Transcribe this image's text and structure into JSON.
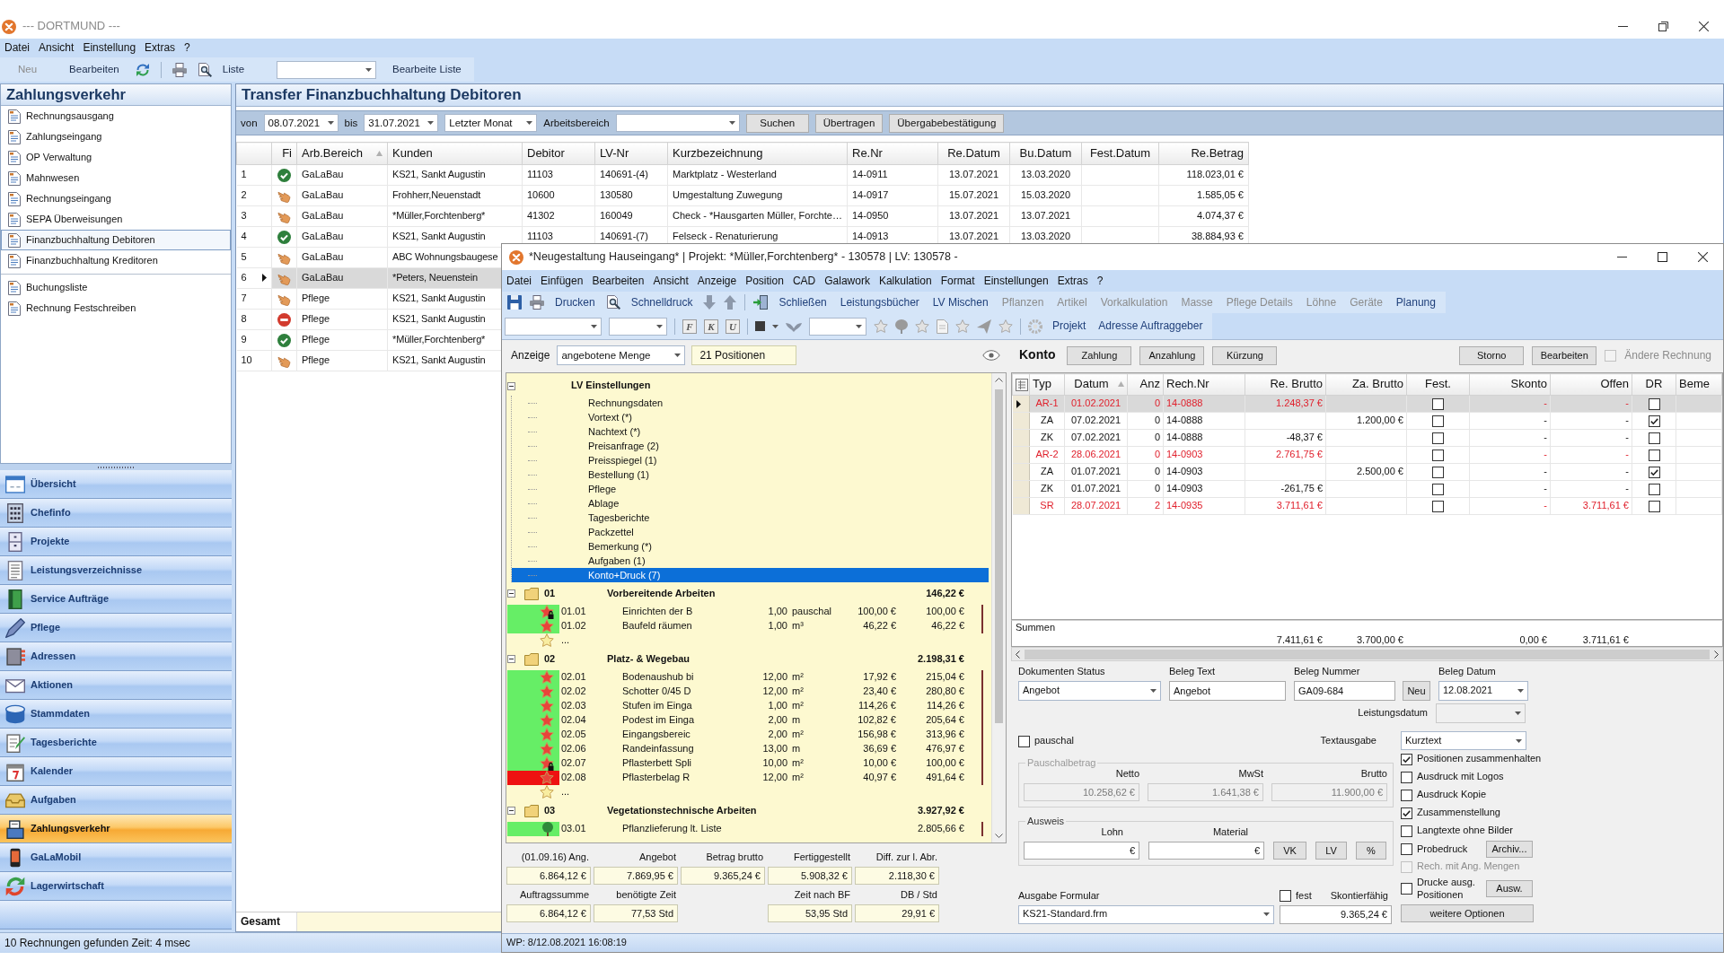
{
  "window": {
    "title": "--- DORTMUND ---"
  },
  "menu": [
    "Datei",
    "Ansicht",
    "Einstellung",
    "Extras",
    "?"
  ],
  "toolbar": {
    "buttons": [
      {
        "label": "Neu",
        "disabled": true
      },
      {
        "label": "Bearbeiten",
        "disabled": false
      }
    ],
    "list_label": "Liste",
    "list_button": "Bearbeite Liste"
  },
  "sidebar": {
    "title": "Zahlungsverkehr",
    "groups": [
      [
        {
          "label": "Rechnungsausgang",
          "selected": false
        },
        {
          "label": "Zahlungseingang",
          "selected": false
        },
        {
          "label": "OP Verwaltung",
          "selected": false
        },
        {
          "label": "Mahnwesen",
          "selected": false
        },
        {
          "label": "Rechnungseingang",
          "selected": false
        },
        {
          "label": "SEPA Überweisungen",
          "selected": false
        },
        {
          "label": "Finanzbuchhaltung Debitoren",
          "selected": true
        },
        {
          "label": "Finanzbuchhaltung Kreditoren",
          "selected": false
        }
      ],
      [
        {
          "label": "Buchungsliste",
          "selected": false
        },
        {
          "label": "Rechnung Festschreiben",
          "selected": false
        }
      ]
    ],
    "modules": [
      {
        "label": "Übersicht",
        "selected": false
      },
      {
        "label": "Chefinfo",
        "selected": false
      },
      {
        "label": "Projekte",
        "selected": false
      },
      {
        "label": "Leistungsverzeichnisse",
        "selected": false
      },
      {
        "label": "Service Aufträge",
        "selected": false
      },
      {
        "label": "Pflege",
        "selected": false
      },
      {
        "label": "Adressen",
        "selected": false
      },
      {
        "label": "Aktionen",
        "selected": false
      },
      {
        "label": "Stammdaten",
        "selected": false
      },
      {
        "label": "Tagesberichte",
        "selected": false
      },
      {
        "label": "Kalender",
        "selected": false
      },
      {
        "label": "Aufgaben",
        "selected": false
      },
      {
        "label": "Zahlungsverkehr",
        "selected": true
      },
      {
        "label": "GaLaMobil",
        "selected": false
      },
      {
        "label": "Lagerwirtschaft",
        "selected": false
      }
    ]
  },
  "transfer": {
    "title": "Transfer Finanzbuchhaltung Debitoren",
    "filter": {
      "from_label": "von",
      "from": "08.07.2021",
      "to_label": "bis",
      "to": "31.07.2021",
      "period": "Letzter Monat",
      "area_label": "Arbeitsbereich",
      "buttons": [
        "Suchen",
        "Übertragen",
        "Übergabebestätigung"
      ]
    },
    "table": {
      "columns": [
        {
          "label": "Fi",
          "sorted": false
        },
        {
          "label": "Arb.Bereich",
          "sorted": true
        },
        {
          "label": "Kunden",
          "sorted": false
        },
        {
          "label": "Debitor",
          "sorted": false
        },
        {
          "label": "LV-Nr",
          "sorted": false
        },
        {
          "label": "Kurzbezeichnung",
          "sorted": false
        },
        {
          "label": "Re.Nr",
          "sorted": false
        },
        {
          "label": "Re.Datum",
          "sorted": false
        },
        {
          "label": "Bu.Datum",
          "sorted": false
        },
        {
          "label": "Fest.Datum",
          "sorted": false
        },
        {
          "label": "Re.Betrag",
          "sorted": false
        }
      ],
      "rows": [
        {
          "number": "1",
          "kind": "ok",
          "selected": false,
          "cells": [
            "",
            "GaLaBau",
            "KS21, Sankt Augustin",
            "11103",
            "140691-(4)",
            "Marktplatz - Westerland",
            "14-0911",
            "13.07.2021",
            "13.03.2020",
            "",
            "118.023,01 €"
          ]
        },
        {
          "number": "2",
          "kind": "open",
          "selected": false,
          "cells": [
            "",
            "GaLaBau",
            "Frohherr,Neuenstadt",
            "10600",
            "130580",
            "Umgestaltung Zuwegung",
            "14-0917",
            "15.07.2021",
            "15.03.2020",
            "",
            "1.585,05 €"
          ]
        },
        {
          "number": "3",
          "kind": "open",
          "selected": false,
          "cells": [
            "",
            "GaLaBau",
            "*Müller,Forchtenberg*",
            "41302",
            "160049",
            "Check - *Hausgarten Müller, Forchte…",
            "14-0950",
            "13.07.2021",
            "13.07.2021",
            "",
            "4.074,37 €"
          ]
        },
        {
          "number": "4",
          "kind": "ok",
          "selected": false,
          "cells": [
            "",
            "GaLaBau",
            "KS21, Sankt Augustin",
            "11103",
            "140691-(7)",
            "Felseck - Renaturierung",
            "14-0913",
            "13.07.2021",
            "13.03.2020",
            "",
            "38.884,93 €"
          ]
        },
        {
          "number": "5",
          "kind": "open",
          "selected": false,
          "cells": [
            "",
            "GaLaBau",
            "ABC  Wohnungsbaugese"
          ]
        },
        {
          "number": "6",
          "kind": "open",
          "selected": true,
          "cells": [
            "",
            "GaLaBau",
            "*Peters, Neuenstein"
          ]
        },
        {
          "number": "7",
          "kind": "open",
          "selected": false,
          "cells": [
            "",
            "Pflege",
            "KS21, Sankt Augustin"
          ]
        },
        {
          "number": "8",
          "kind": "error",
          "selected": false,
          "cells": [
            "",
            "Pflege",
            "KS21, Sankt Augustin"
          ]
        },
        {
          "number": "9",
          "kind": "ok",
          "selected": false,
          "cells": [
            "",
            "Pflege",
            "*Müller,Forchtenberg*"
          ]
        },
        {
          "number": "10",
          "kind": "open",
          "selected": false,
          "cells": [
            "",
            "Pflege",
            "KS21, Sankt Augustin"
          ]
        }
      ]
    },
    "footer": "Gesamt"
  },
  "status_bar": "10 Rechnungen gefunden Zeit: 4 msec",
  "project_window": {
    "title": "*Neugestaltung Hauseingang* | Projekt: *Müller,Forchtenberg* - 130578 | LV: 130578 -",
    "menu": [
      "Datei",
      "Einfügen",
      "Bearbeiten",
      "Ansicht",
      "Anzeige",
      "Position",
      "CAD",
      "Galawork",
      "Kalkulation",
      "Format",
      "Einstellungen",
      "Extras",
      "?"
    ],
    "toolbar": [
      {
        "label": "Drucken",
        "disabled": false
      },
      {
        "label": "Schnelldruck",
        "disabled": false
      },
      {
        "label": "Schließen",
        "disabled": false
      },
      {
        "label": "Leistungsbücher",
        "disabled": false
      },
      {
        "label": "LV Mischen",
        "disabled": false
      },
      {
        "label": "Pflanzen",
        "disabled": true
      },
      {
        "label": "Artikel",
        "disabled": true
      },
      {
        "label": "Vorkalkulation",
        "disabled": true
      },
      {
        "label": "Masse",
        "disabled": true
      },
      {
        "label": "Pflege Details",
        "disabled": true
      },
      {
        "label": "Löhne",
        "disabled": true
      },
      {
        "label": "Geräte",
        "disabled": true
      },
      {
        "label": "Planung",
        "disabled": false
      }
    ],
    "format_buttons": [
      "F",
      "K",
      "U"
    ],
    "links": [
      "Projekt",
      "Adresse Auftraggeber"
    ],
    "display": {
      "label": "Anzeige",
      "value": "angebotene Menge",
      "count": "21 Positionen"
    },
    "tree": {
      "settings": {
        "label": "LV Einstellungen",
        "expanded": true,
        "children": [
          {
            "label": "Rechnungsdaten",
            "selected": false
          },
          {
            "label": "Vortext (*)",
            "selected": false
          },
          {
            "label": "Nachtext (*)",
            "selected": false
          },
          {
            "label": "Preisanfrage (2)",
            "selected": false
          },
          {
            "label": "Preisspiegel (1)",
            "selected": false
          },
          {
            "label": "Bestellung (1)",
            "selected": false
          },
          {
            "label": "Pflege",
            "selected": false
          },
          {
            "label": "Ablage",
            "selected": false
          },
          {
            "label": "Tagesberichte",
            "selected": false
          },
          {
            "label": "Packzettel",
            "selected": false
          },
          {
            "label": "Bemerkung (*)",
            "selected": false
          },
          {
            "label": "Aufgaben (1)",
            "selected": false
          },
          {
            "label": "Konto+Druck (7)",
            "selected": true
          }
        ]
      },
      "groups": [
        {
          "number": "01",
          "title": "Vorbereitende Arbeiten",
          "total": "146,22 €",
          "expanded": true,
          "children": [
            {
              "kind": "item",
              "number": "01.01",
              "text": "Einrichten der B",
              "quantity": "1,00",
              "unit": "pauschal",
              "price": "100,00 €",
              "total": "100,00 €",
              "color": "#66ee66",
              "locked": true
            },
            {
              "kind": "item",
              "number": "01.02",
              "text": "Baufeld räumen",
              "quantity": "1,00",
              "unit": "m³",
              "price": "46,22 €",
              "total": "46,22 €",
              "color": "#66ee66",
              "locked": false
            },
            {
              "kind": "add",
              "text": "..."
            }
          ]
        },
        {
          "number": "02",
          "title": "Platz- & Wegebau",
          "total": "2.198,31 €",
          "expanded": true,
          "children": [
            {
              "kind": "item",
              "number": "02.01",
              "text": "Bodenaushub bi",
              "quantity": "12,00",
              "unit": "m²",
              "price": "17,92 €",
              "total": "215,04 €",
              "color": "#66ee66",
              "locked": false
            },
            {
              "kind": "item",
              "number": "02.02",
              "text": "Schotter 0/45 D",
              "quantity": "12,00",
              "unit": "m²",
              "price": "23,40 €",
              "total": "280,80 €",
              "color": "#66ee66",
              "locked": false
            },
            {
              "kind": "item",
              "number": "02.03",
              "text": "Stufen im Einga",
              "quantity": "1,00",
              "unit": "m²",
              "price": "114,26 €",
              "total": "114,26 €",
              "color": "#66ee66",
              "locked": false
            },
            {
              "kind": "item",
              "number": "02.04",
              "text": "Podest im Einga",
              "quantity": "2,00",
              "unit": "m",
              "price": "102,82 €",
              "total": "205,64 €",
              "color": "#66ee66",
              "locked": false
            },
            {
              "kind": "item",
              "number": "02.05",
              "text": "Eingangsbereic",
              "quantity": "2,00",
              "unit": "m²",
              "price": "156,98 €",
              "total": "313,96 €",
              "color": "#66ee66",
              "locked": false
            },
            {
              "kind": "item",
              "number": "02.06",
              "text": "Randeinfassung",
              "quantity": "13,00",
              "unit": "m",
              "price": "36,69 €",
              "total": "476,97 €",
              "color": "#66ee66",
              "locked": false
            },
            {
              "kind": "item",
              "number": "02.07",
              "text": "Pflasterbett Spli",
              "quantity": "10,00",
              "unit": "m²",
              "price": "10,00 €",
              "total": "100,00 €",
              "color": "#66ee66",
              "locked": true
            },
            {
              "kind": "item",
              "number": "02.08",
              "text": "Pflasterbelag R",
              "quantity": "12,00",
              "unit": "m²",
              "price": "40,97 €",
              "total": "491,64 €",
              "color": "#ee1111",
              "locked": false
            },
            {
              "kind": "add",
              "text": "..."
            }
          ]
        },
        {
          "number": "03",
          "title": "Vegetationstechnische Arbeiten",
          "total": "3.927,92 €",
          "expanded": true,
          "children": [
            {
              "kind": "plant",
              "number": "03.01",
              "text": "Pflanzlieferung lt. Liste",
              "total": "2.805,66 €",
              "color": "#66ee66"
            }
          ]
        }
      ]
    },
    "summary": [
      [
        {
          "label": "(01.09.16) Ang.",
          "value": "6.864,12 €"
        },
        {
          "label": "Auftragssumme",
          "value": "6.864,12 €"
        }
      ],
      [
        {
          "label": "Angebot",
          "value": "7.869,95 €"
        },
        {
          "label": "benötigte Zeit",
          "value": "77,53 Std"
        }
      ],
      [
        {
          "label": "Betrag brutto",
          "value": "9.365,24 €"
        }
      ],
      [
        {
          "label": "Fertiggestellt",
          "value": "5.908,32 €"
        },
        {
          "label": "Zeit nach BF",
          "value": "53,95 Std"
        }
      ],
      [
        {
          "label": "Diff. zur l. Abr.",
          "value": "2.118,30 €"
        },
        {
          "label": "DB / Std",
          "value": "29,91 €"
        }
      ]
    ],
    "account": {
      "title": "Konto",
      "buttons": [
        "Zahlung",
        "Anzahlung",
        "Kürzung"
      ],
      "right_buttons": [
        "Storno",
        "Bearbeiten"
      ],
      "other_invoice": {
        "label": "Ändere Rechnung",
        "checked": false,
        "disabled": true
      },
      "columns": [
        {
          "label": "Typ",
          "sorted": false
        },
        {
          "label": "Datum",
          "sorted": true
        },
        {
          "label": "Anz",
          "sorted": false
        },
        {
          "label": "Rech.Nr",
          "sorted": false
        },
        {
          "label": "Re. Brutto",
          "sorted": false
        },
        {
          "label": "Za. Brutto",
          "sorted": false
        },
        {
          "label": "Fest.",
          "sorted": false
        },
        {
          "label": "Skonto",
          "sorted": false
        },
        {
          "label": "Offen",
          "sorted": false
        },
        {
          "label": "DR",
          "sorted": false
        },
        {
          "label": "Beme",
          "sorted": false
        }
      ],
      "rows": [
        {
          "kind": "invoice",
          "selected": true,
          "typ": "AR-1",
          "datum": "01.02.2021",
          "anz": "0",
          "rech_nr": "14-0888",
          "re_brutto": "1.248,37 €",
          "fest": false,
          "skonto": "-",
          "offen": "-",
          "dr": false
        },
        {
          "kind": "payment",
          "selected": false,
          "typ": "ZA",
          "datum": "07.02.2021",
          "anz": "0",
          "rech_nr": "14-0888",
          "za_brutto": "1.200,00 €",
          "fest": false,
          "skonto": "-",
          "offen": "-",
          "dr": true
        },
        {
          "kind": "payment",
          "selected": false,
          "typ": "ZK",
          "datum": "07.02.2021",
          "anz": "0",
          "rech_nr": "14-0888",
          "re_brutto": "-48,37 €",
          "fest": false,
          "skonto": "-",
          "offen": "-",
          "dr": false
        },
        {
          "kind": "invoice",
          "selected": false,
          "typ": "AR-2",
          "datum": "28.06.2021",
          "anz": "0",
          "rech_nr": "14-0903",
          "re_brutto": "2.761,75 €",
          "fest": false,
          "skonto": "-",
          "offen": "-",
          "dr": false
        },
        {
          "kind": "payment",
          "selected": false,
          "typ": "ZA",
          "datum": "01.07.2021",
          "anz": "0",
          "rech_nr": "14-0903",
          "za_brutto": "2.500,00 €",
          "fest": false,
          "skonto": "-",
          "offen": "-",
          "dr": true
        },
        {
          "kind": "payment",
          "selected": false,
          "typ": "ZK",
          "datum": "01.07.2021",
          "anz": "0",
          "rech_nr": "14-0903",
          "re_brutto": "-261,75 €",
          "fest": false,
          "skonto": "-",
          "offen": "-",
          "dr": false
        },
        {
          "kind": "invoice",
          "selected": false,
          "typ": "SR",
          "datum": "28.07.2021",
          "anz": "2",
          "rech_nr": "14-0935",
          "re_brutto": "3.711,61 €",
          "fest": false,
          "skonto": "-",
          "offen": "3.711,61 €",
          "dr": false
        }
      ],
      "totals_label": "Summen",
      "totals": {
        "re_brutto": "7.411,61 €",
        "za_brutto": "3.700,00 €",
        "skonto": "0,00 €",
        "offen": "3.711,61 €"
      }
    },
    "document": {
      "status_label": "Dokumenten Status",
      "status": "Angebot",
      "text_label": "Beleg Text",
      "text": "Angebot",
      "number_label": "Beleg Nummer",
      "number": "GA09-684",
      "new_button": "Neu",
      "date_label": "Beleg Datum",
      "date": "12.08.2021",
      "service_date": {
        "label": "Leistungsdatum",
        "disabled": true
      },
      "flat": {
        "label": "pauschal",
        "checked": false
      },
      "text_output_label": "Textausgabe",
      "text_output": "Kurztext",
      "flat_amount": {
        "legend": "Pauschalbetrag",
        "disabled": true,
        "fields": [
          {
            "label": "Netto",
            "value": "10.258,62 €"
          },
          {
            "label": "MwSt",
            "value": "1.641,38 €"
          },
          {
            "label": "Brutto",
            "value": "11.900,00 €"
          }
        ]
      },
      "breakdown": {
        "legend": "Ausweis",
        "fields": [
          {
            "label": "Lohn",
            "value": "€"
          },
          {
            "label": "Material",
            "value": "€"
          }
        ],
        "buttons": [
          "VK",
          "LV",
          "%"
        ]
      },
      "options": [
        {
          "label": "Positionen zusammenhalten",
          "checked": true,
          "disabled": false
        },
        {
          "label": "Ausdruck mit Logos",
          "checked": false,
          "disabled": false
        },
        {
          "label": "Ausdruck Kopie",
          "checked": false,
          "disabled": false
        },
        {
          "label": "Zusammenstellung",
          "checked": true,
          "disabled": false
        },
        {
          "label": "Langtexte ohne Bilder",
          "checked": false,
          "disabled": false
        },
        {
          "label": "Probedruck",
          "checked": false,
          "disabled": false,
          "button": "Archiv..."
        },
        {
          "label": "Rech. mit Ang. Mengen",
          "checked": false,
          "disabled": true
        },
        {
          "label": "Drucke ausg. Positionen",
          "checked": false,
          "disabled": false,
          "button": "Ausw."
        }
      ],
      "more_button": "weitere Optionen",
      "form_label": "Ausgabe Formular",
      "form": "KS21-Standard.frm",
      "fixed": {
        "label": "fest",
        "checked": false
      },
      "discount_label": "Skontierfähig",
      "discount": "9.365,24 €"
    },
    "status_bar": "WP: 8/12.08.2021 16:08:19"
  }
}
